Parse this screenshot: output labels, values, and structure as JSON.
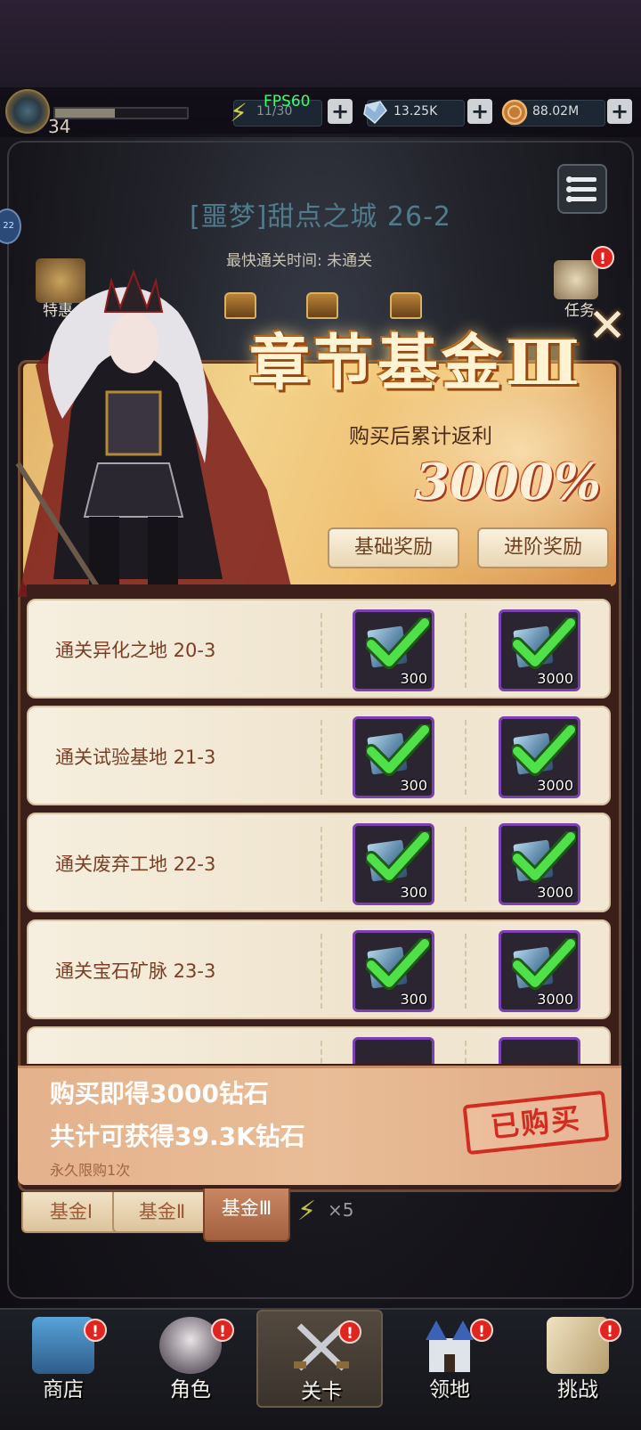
{
  "colors": {
    "accent_gold": "#f2d28b",
    "purple_frame": "#7c3fb4",
    "check_green": "#3fcf3a",
    "stamp_red": "#d22c22",
    "fps_green": "#3bff6b"
  },
  "hud": {
    "level": "34",
    "exp_fraction": 0.45,
    "fps": "FPS60",
    "energy": "11/30",
    "energy_icon": "lightning-icon",
    "diamonds": "13.25K",
    "diamond_icon": "diamond-icon",
    "gold": "88.02M",
    "gold_icon": "coin-icon",
    "side_badge": "22"
  },
  "stage": {
    "title": "[噩梦]甜点之城 26-2",
    "fastest_clear": "最快通关时间:  未通关",
    "special_label": "特惠",
    "quest_label": "任务"
  },
  "fund": {
    "title": "章节基金Ⅲ",
    "return_label": "购买后累计返利",
    "return_value": "3000%",
    "tab_basic": "基础奖励",
    "tab_advanced": "进阶奖励",
    "rows": [
      {
        "label": "通关异化之地 20-3",
        "basic": "300",
        "advanced": "3000"
      },
      {
        "label": "通关试验基地 21-3",
        "basic": "300",
        "advanced": "3000"
      },
      {
        "label": "通关废弃工地 22-3",
        "basic": "300",
        "advanced": "3000"
      },
      {
        "label": "通关宝石矿脉 23-3",
        "basic": "300",
        "advanced": "3000"
      }
    ],
    "buy_line1": "购买即得3000钻石",
    "buy_line2": "共计可获得39.3K钻石",
    "buy_limit": "永久限购1次",
    "purchased": "已购买"
  },
  "fund_tabs": [
    {
      "label": "基金Ⅰ"
    },
    {
      "label": "基金Ⅱ"
    },
    {
      "label": "基金Ⅲ"
    }
  ],
  "energy_multiplier": "×5",
  "nav": [
    {
      "label": "商店",
      "badge": "!",
      "icon": "shop-icon"
    },
    {
      "label": "角色",
      "badge": "!",
      "icon": "character-icon"
    },
    {
      "label": "关卡",
      "badge": "!",
      "icon": "crossed-swords-icon"
    },
    {
      "label": "领地",
      "badge": "!",
      "icon": "castle-icon"
    },
    {
      "label": "挑战",
      "badge": "!",
      "icon": "scroll-icon"
    }
  ]
}
